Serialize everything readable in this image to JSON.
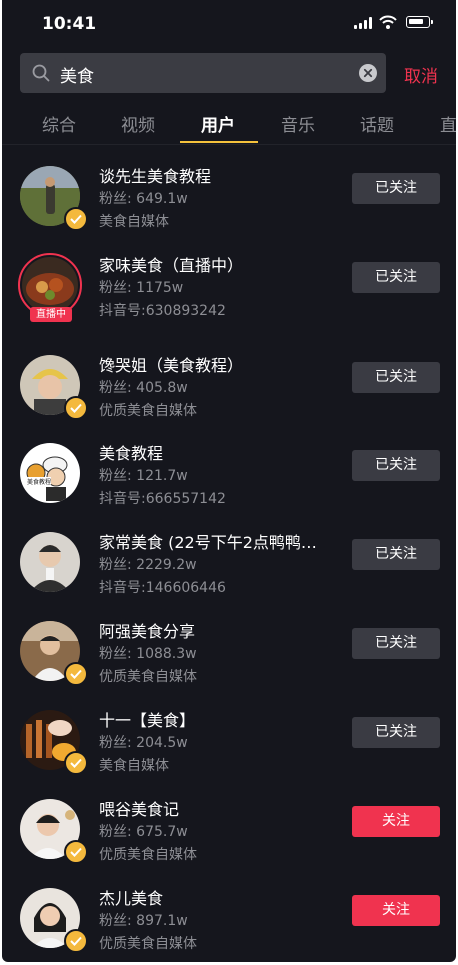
{
  "status_bar": {
    "time": "10:41"
  },
  "search": {
    "query": "美食",
    "cancel_label": "取消"
  },
  "tabs": [
    {
      "label": "综合"
    },
    {
      "label": "视频"
    },
    {
      "label": "用户"
    },
    {
      "label": "音乐"
    },
    {
      "label": "话题"
    },
    {
      "label": "直"
    }
  ],
  "colors": {
    "accent_red": "#f0334f",
    "tab_underline": "#f5c23c",
    "verified": "#f4b93d",
    "background": "#15161d"
  },
  "users": [
    {
      "name": "谈先生美食教程",
      "fans": "粉丝: 649.1w",
      "sub": "美食自媒体",
      "button": "已关注",
      "verified": true
    },
    {
      "name": "家味美食（直播中）",
      "fans": "粉丝: 1175w",
      "sub": "抖音号:630893242",
      "button": "已关注",
      "live_badge": "直播中"
    },
    {
      "name": "馋哭姐（美食教程）",
      "fans": "粉丝: 405.8w",
      "sub": "优质美食自媒体",
      "button": "已关注",
      "verified": true
    },
    {
      "name": "美食教程",
      "fans": "粉丝: 121.7w",
      "sub": "抖音号:666557142",
      "button": "已关注",
      "avatar_text": "美食教程"
    },
    {
      "name": "家常美食 (22号下午2点鸭鸭…",
      "fans": "粉丝: 2229.2w",
      "sub": "抖音号:146606446",
      "button": "已关注"
    },
    {
      "name": "阿强美食分享",
      "fans": "粉丝: 1088.3w",
      "sub": "优质美食自媒体",
      "button": "已关注",
      "verified": true
    },
    {
      "name": "十一【美食】",
      "fans": "粉丝: 204.5w",
      "sub": "美食自媒体",
      "button": "已关注",
      "verified": true
    },
    {
      "name": "喂谷美食记",
      "fans": "粉丝: 675.7w",
      "sub": "优质美食自媒体",
      "button": "关注",
      "verified": true
    },
    {
      "name": "杰儿美食",
      "fans": "粉丝: 897.1w",
      "sub": "优质美食自媒体",
      "button": "关注",
      "verified": true
    }
  ]
}
